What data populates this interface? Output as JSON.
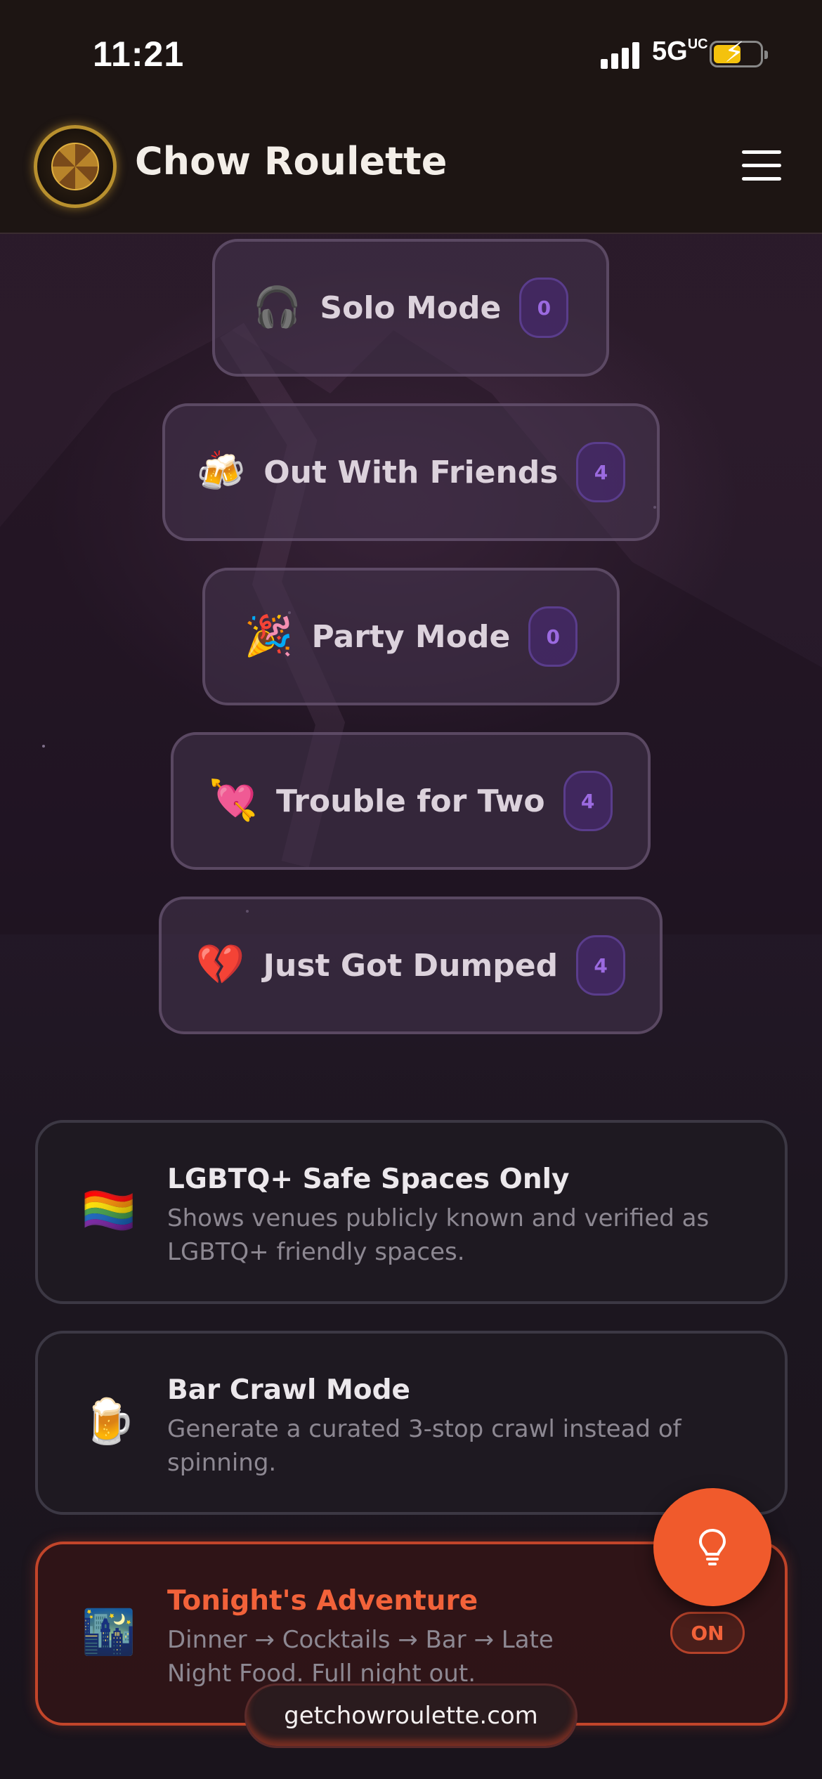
{
  "status_bar": {
    "time": "11:21",
    "network": "5G",
    "network_suffix": "UC",
    "battery_icon": "battery-charging-icon"
  },
  "header": {
    "app_name": "Chow Roulette",
    "logo": "chow-roulette-logo",
    "menu_icon": "hamburger-menu-icon"
  },
  "modes": [
    {
      "emoji": "🎧",
      "label": "Solo Mode",
      "count": "0"
    },
    {
      "emoji": "🍻",
      "label": "Out With Friends",
      "count": "4"
    },
    {
      "emoji": "🎉",
      "label": "Party Mode",
      "count": "0"
    },
    {
      "emoji": "💘",
      "label": "Trouble for Two",
      "count": "4"
    },
    {
      "emoji": "💔",
      "label": "Just Got Dumped",
      "count": "4"
    }
  ],
  "options": [
    {
      "emoji": "🏳️‍🌈",
      "title": "LGBTQ+ Safe Spaces Only",
      "description": "Shows venues publicly known and verified as LGBTQ+ friendly spaces."
    },
    {
      "emoji": "🍺",
      "title": "Bar Crawl Mode",
      "description": "Generate a curated 3-stop crawl instead of spinning."
    },
    {
      "emoji": "🌃",
      "title": "Tonight's Adventure",
      "description": "Dinner → Cocktails → Bar → Late Night Food. Full night out.",
      "badge": "ON"
    }
  ],
  "fab": {
    "icon": "lightbulb-icon"
  },
  "footer": {
    "url": "getchowroulette.com"
  },
  "colors": {
    "accent": "#f05a2c",
    "count_text": "#9b6ae0",
    "background": "#1a1218"
  }
}
